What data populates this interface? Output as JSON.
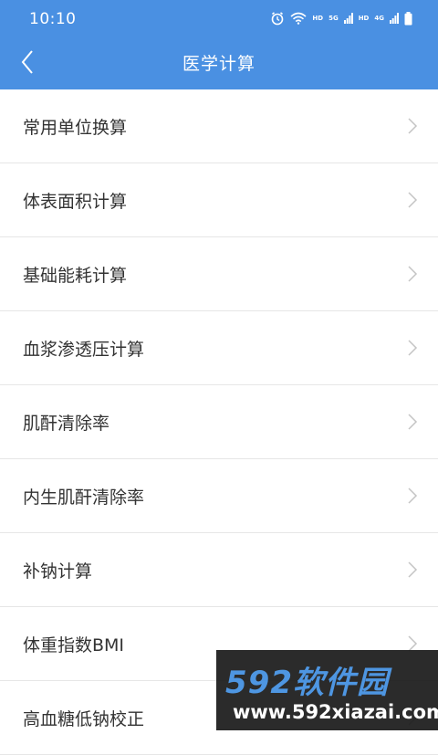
{
  "status_bar": {
    "time": "10:10",
    "hd1": "HD",
    "net1": "5G",
    "hd2": "HD",
    "net2": "4G"
  },
  "header": {
    "title": "医学计算"
  },
  "list": {
    "items": [
      {
        "label": "常用单位换算"
      },
      {
        "label": "体表面积计算"
      },
      {
        "label": "基础能耗计算"
      },
      {
        "label": "血浆渗透压计算"
      },
      {
        "label": "肌酐清除率"
      },
      {
        "label": "内生肌酐清除率"
      },
      {
        "label": "补钠计算"
      },
      {
        "label": "体重指数BMI"
      },
      {
        "label": "高血糖低钠校正"
      }
    ]
  },
  "watermark": {
    "main": "592软件园",
    "sub": "www.592xiazai.com"
  },
  "colors": {
    "header_bg": "#4a90e2",
    "divider": "#e6e6e6",
    "chevron": "#c4c4c4",
    "label_text": "#333333"
  },
  "icons": {
    "back": "chevron-left-icon",
    "row": "chevron-right-icon"
  }
}
